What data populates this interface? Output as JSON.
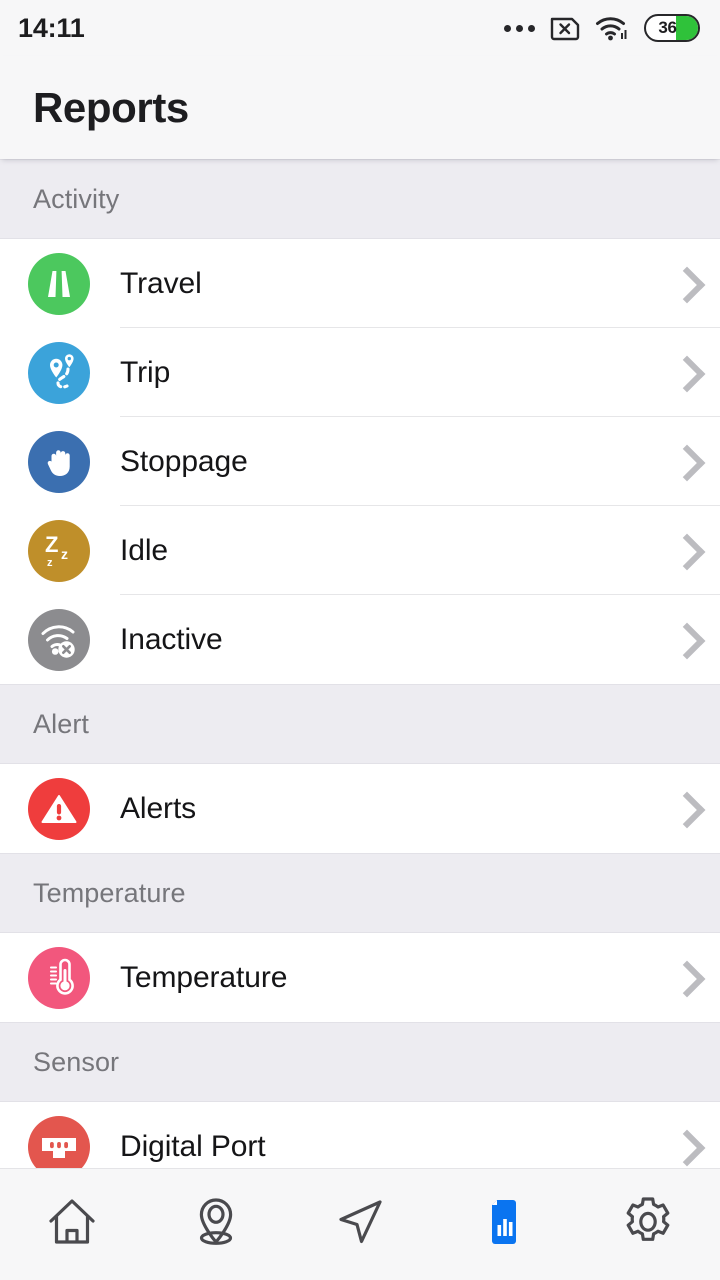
{
  "status_bar": {
    "time": "14:11",
    "battery_level": "36",
    "battery_fill_color": "#2fc23a",
    "icons": [
      "more-dots-icon",
      "sim-card-off-icon",
      "wifi-icon",
      "battery-icon"
    ]
  },
  "app_bar": {
    "title": "Reports"
  },
  "sections": [
    {
      "title": "Activity",
      "rows": [
        {
          "label": "Travel",
          "icon": "road-icon",
          "color": "#4cc85e"
        },
        {
          "label": "Trip",
          "icon": "route-pins-icon",
          "color": "#3ba3da"
        },
        {
          "label": "Stoppage",
          "icon": "hand-stop-icon",
          "color": "#3b6fb0"
        },
        {
          "label": "Idle",
          "icon": "sleep-zzz-icon",
          "color": "#bf8f2a"
        },
        {
          "label": "Inactive",
          "icon": "wifi-off-icon",
          "color": "#8c8c8f"
        }
      ]
    },
    {
      "title": "Alert",
      "rows": [
        {
          "label": "Alerts",
          "icon": "warning-triangle-icon",
          "color": "#ef3d3d"
        }
      ]
    },
    {
      "title": "Temperature",
      "rows": [
        {
          "label": "Temperature",
          "icon": "thermometer-icon",
          "color": "#f2577d"
        }
      ]
    },
    {
      "title": "Sensor",
      "rows": [
        {
          "label": "Digital Port",
          "icon": "connector-port-icon",
          "color": "#e3564e"
        }
      ]
    }
  ],
  "bottom_nav": {
    "active_color": "#0a74f0",
    "inactive_color": "#4a4a4e",
    "items": [
      {
        "name": "home",
        "icon": "home-icon",
        "active": false
      },
      {
        "name": "places",
        "icon": "map-pin-icon",
        "active": false
      },
      {
        "name": "navigate",
        "icon": "navigation-icon",
        "active": false
      },
      {
        "name": "reports",
        "icon": "report-chart-icon",
        "active": true
      },
      {
        "name": "settings",
        "icon": "gear-icon",
        "active": false
      }
    ]
  }
}
